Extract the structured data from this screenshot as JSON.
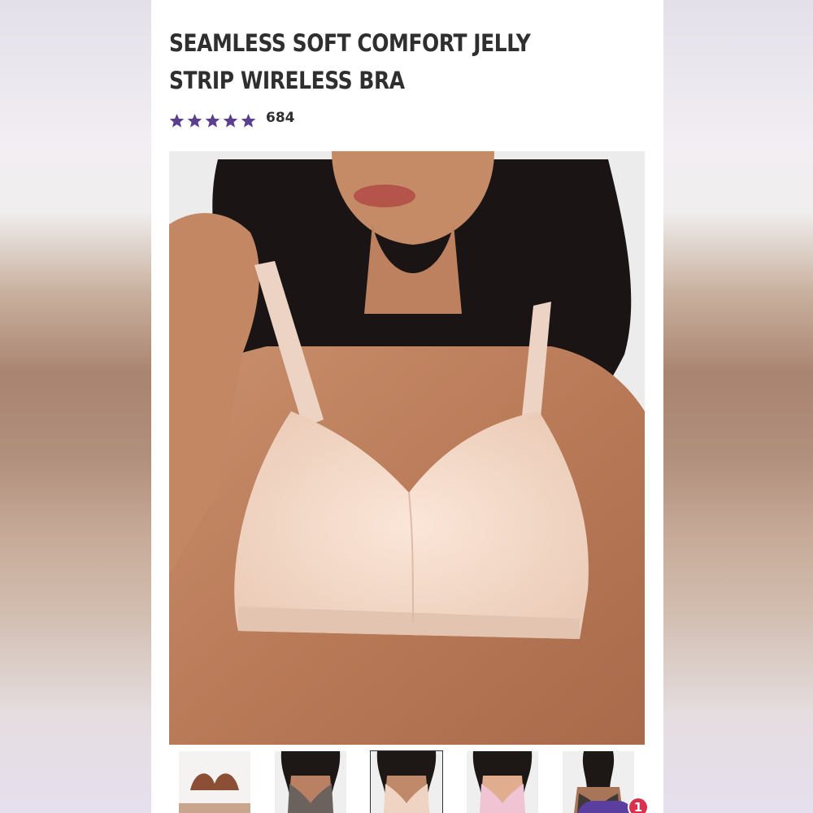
{
  "product": {
    "title": "SEAMLESS SOFT COMFORT JELLY STRIP WIRELESS BRA",
    "rating_stars": 5,
    "rating_max": 5,
    "review_count": "684",
    "main_image_icon": "product-photo-nude-bra"
  },
  "thumbnails": [
    {
      "name": "thumb-bra-flatlay",
      "color": "#8a4f35",
      "selected": false
    },
    {
      "name": "thumb-bra-grey",
      "color": "#6b625d",
      "selected": false
    },
    {
      "name": "thumb-bra-nude",
      "color": "#efd4c3",
      "selected": true
    },
    {
      "name": "thumb-bra-pink",
      "color": "#f0c4d3",
      "selected": false
    },
    {
      "name": "thumb-bra-lace",
      "color": "#3f3a38",
      "selected": false
    }
  ],
  "cart": {
    "badge_count": "1"
  },
  "colors": {
    "star": "#5b3f8f",
    "title_text": "#2f2f2f",
    "accent": "#5b3fa0",
    "badge": "#d9304f"
  }
}
